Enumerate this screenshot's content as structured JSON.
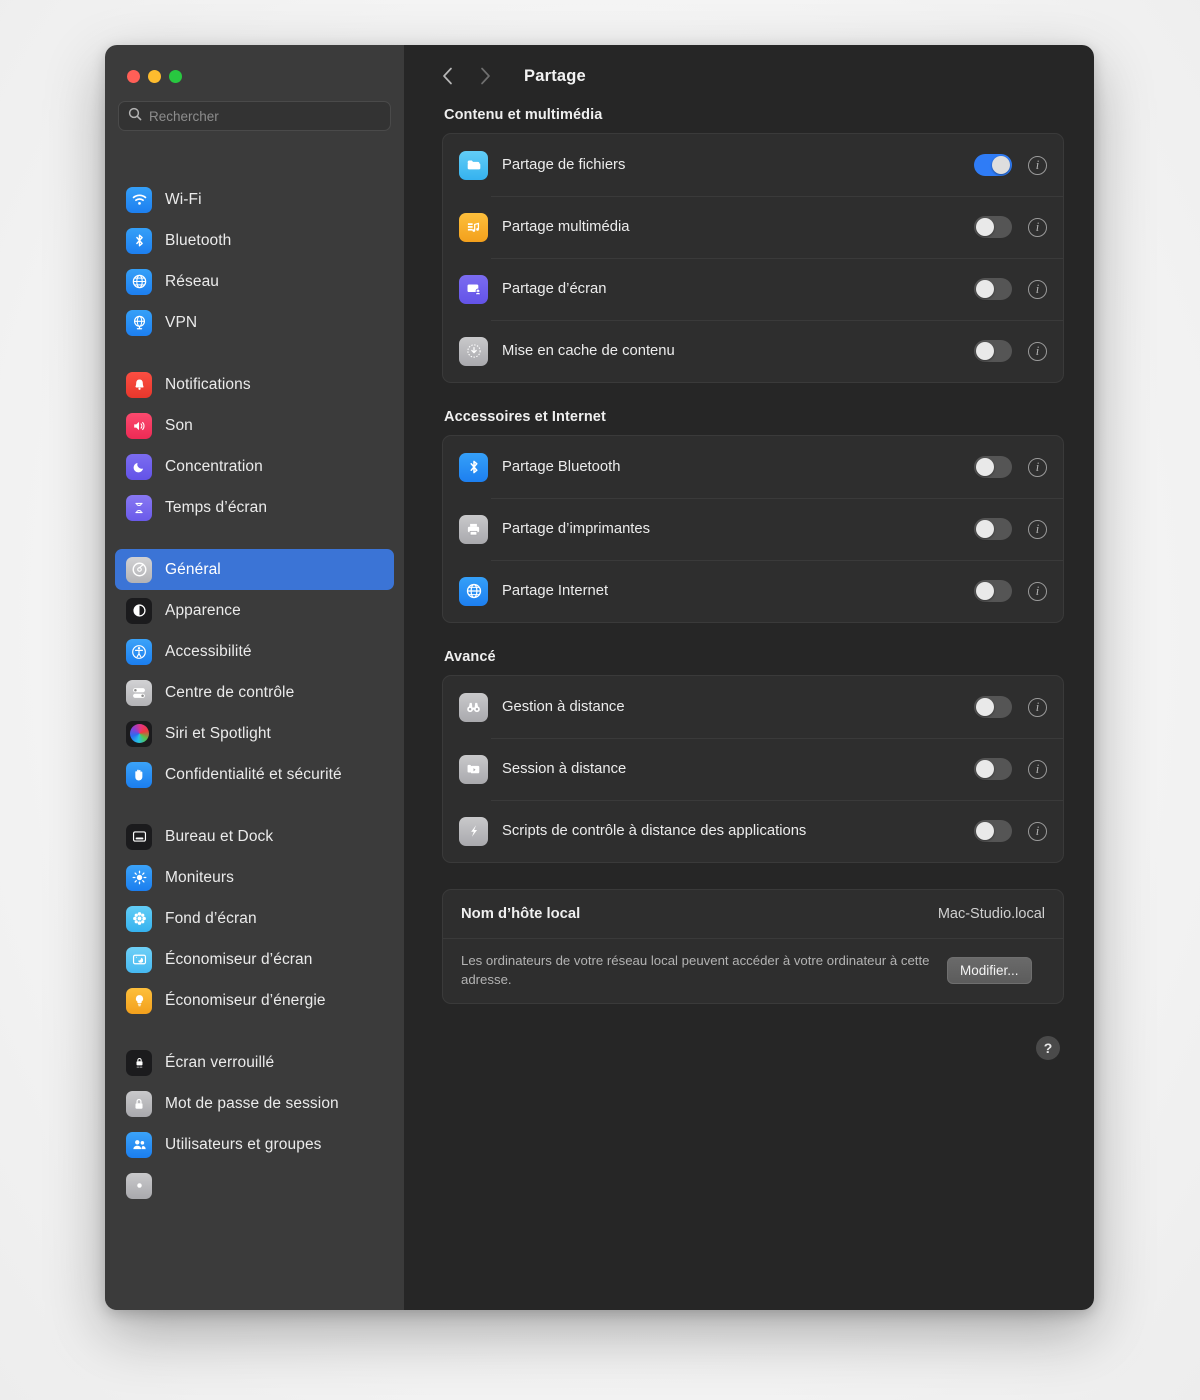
{
  "window": {
    "traffic_lights": [
      "close",
      "minimize",
      "zoom"
    ],
    "colors": {
      "close": "#ff5f57",
      "minimize": "#febc2e",
      "zoom": "#28c840",
      "accent": "#3b74d6",
      "toggle_on": "#2f7cf6",
      "sidebar_bg": "#3b3b3b",
      "content_bg": "#262626",
      "card_bg": "#2e2e2e"
    }
  },
  "sidebar": {
    "search": {
      "placeholder": "Rechercher",
      "value": "",
      "icon": "search-icon"
    },
    "groups": [
      {
        "items": [
          {
            "label": "Wi-Fi",
            "icon": "wifi-icon",
            "selected": false
          },
          {
            "label": "Bluetooth",
            "icon": "bluetooth-icon",
            "selected": false
          },
          {
            "label": "Réseau",
            "icon": "globe-icon",
            "selected": false
          },
          {
            "label": "VPN",
            "icon": "vpn-globe-icon",
            "selected": false
          }
        ]
      },
      {
        "items": [
          {
            "label": "Notifications",
            "icon": "bell-icon",
            "selected": false
          },
          {
            "label": "Son",
            "icon": "speaker-icon",
            "selected": false
          },
          {
            "label": "Concentration",
            "icon": "moon-icon",
            "selected": false
          },
          {
            "label": "Temps d’écran",
            "icon": "hourglass-icon",
            "selected": false
          }
        ]
      },
      {
        "items": [
          {
            "label": "Général",
            "icon": "gear-icon",
            "selected": true
          },
          {
            "label": "Apparence",
            "icon": "appearance-icon",
            "selected": false
          },
          {
            "label": "Accessibilité",
            "icon": "accessibility-icon",
            "selected": false
          },
          {
            "label": "Centre de contrôle",
            "icon": "control-center-icon",
            "selected": false
          },
          {
            "label": "Siri et Spotlight",
            "icon": "siri-icon",
            "selected": false
          },
          {
            "label": "Confidentialité et sécurité",
            "icon": "hand-icon",
            "selected": false
          }
        ]
      },
      {
        "items": [
          {
            "label": "Bureau et Dock",
            "icon": "desktop-dock-icon",
            "selected": false
          },
          {
            "label": "Moniteurs",
            "icon": "brightness-icon",
            "selected": false
          },
          {
            "label": "Fond d’écran",
            "icon": "wallpaper-icon",
            "selected": false
          },
          {
            "label": "Économiseur d’écran",
            "icon": "screensaver-icon",
            "selected": false
          },
          {
            "label": "Économiseur d’énergie",
            "icon": "energy-bulb-icon",
            "selected": false
          }
        ]
      },
      {
        "items": [
          {
            "label": "Écran verrouillé",
            "icon": "lockscreen-icon",
            "selected": false
          },
          {
            "label": "Mot de passe de session",
            "icon": "lock-icon",
            "selected": false
          },
          {
            "label": "Utilisateurs et groupes",
            "icon": "users-icon",
            "selected": false
          }
        ]
      }
    ]
  },
  "toolbar": {
    "back_icon": "chevron-left-icon",
    "forward_icon": "chevron-right-icon",
    "title": "Partage"
  },
  "main": {
    "sections": [
      {
        "heading": "Contenu et multimédia",
        "rows": [
          {
            "label": "Partage de fichiers",
            "icon": "folder-icon",
            "enabled": true,
            "info": "info-icon"
          },
          {
            "label": "Partage multimédia",
            "icon": "media-icon",
            "enabled": false,
            "info": "info-icon"
          },
          {
            "label": "Partage d’écran",
            "icon": "screen-share-icon",
            "enabled": false,
            "info": "info-icon"
          },
          {
            "label": "Mise en cache de contenu",
            "icon": "content-cache-icon",
            "enabled": false,
            "info": "info-icon"
          }
        ]
      },
      {
        "heading": "Accessoires et Internet",
        "rows": [
          {
            "label": "Partage Bluetooth",
            "icon": "bluetooth-icon",
            "enabled": false,
            "info": "info-icon"
          },
          {
            "label": "Partage d’imprimantes",
            "icon": "printer-icon",
            "enabled": false,
            "info": "info-icon"
          },
          {
            "label": "Partage Internet",
            "icon": "globe-icon",
            "enabled": false,
            "info": "info-icon"
          }
        ]
      },
      {
        "heading": "Avancé",
        "rows": [
          {
            "label": "Gestion à distance",
            "icon": "binoculars-icon",
            "enabled": false,
            "info": "info-icon"
          },
          {
            "label": "Session à distance",
            "icon": "remote-login-icon",
            "enabled": false,
            "info": "info-icon"
          },
          {
            "label": "Scripts de contrôle à distance des applications",
            "icon": "script-icon",
            "enabled": false,
            "info": "info-icon"
          }
        ]
      }
    ],
    "hostname": {
      "label": "Nom d’hôte local",
      "value": "Mac-Studio.local",
      "description": "Les ordinateurs de votre réseau local peuvent accéder à votre ordinateur à cette adresse.",
      "button": "Modifier..."
    },
    "help_button": "?"
  }
}
